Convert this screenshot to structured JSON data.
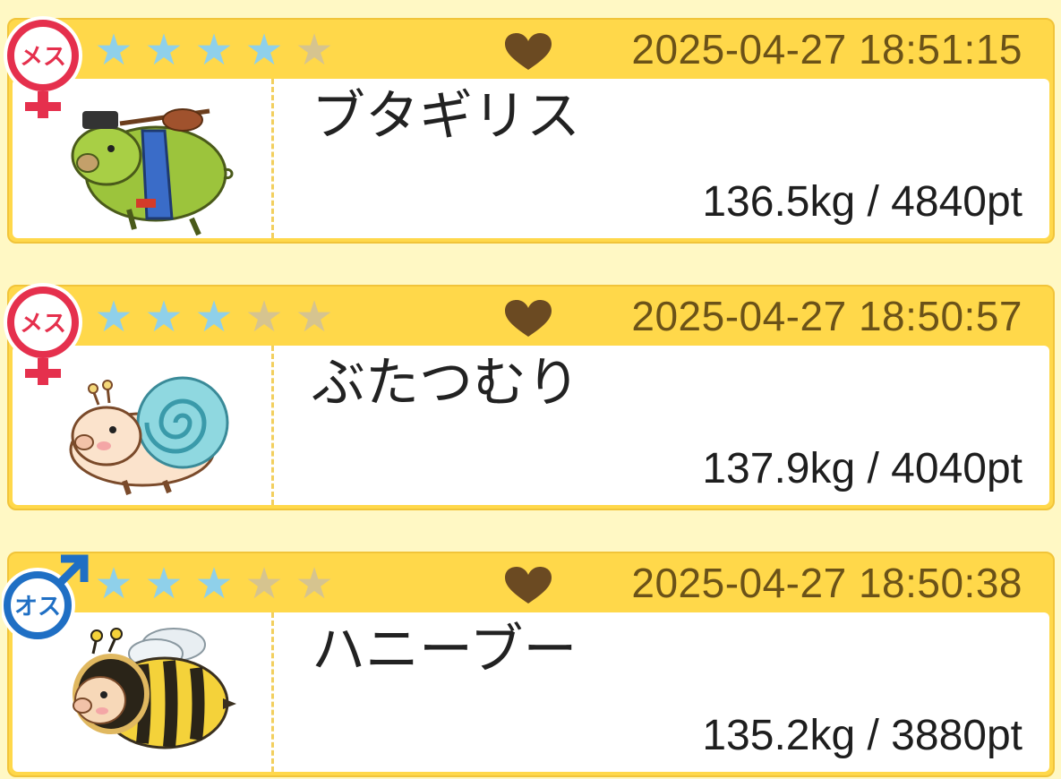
{
  "accent_color": "#ffd84a",
  "star_on_color": "#8fd0ea",
  "star_off_color": "#d6c48f",
  "pigs": [
    {
      "gender_label": "メス",
      "gender": "female",
      "rating": 4,
      "max_rating": 5,
      "datetime": "2025-04-27 18:51:15",
      "name": "ブタギリス",
      "stats": "136.5kg / 4840pt",
      "icon": "grasshopper-pig-icon"
    },
    {
      "gender_label": "メス",
      "gender": "female",
      "rating": 3,
      "max_rating": 5,
      "datetime": "2025-04-27 18:50:57",
      "name": "ぶたつむり",
      "stats": "137.9kg / 4040pt",
      "icon": "snail-pig-icon"
    },
    {
      "gender_label": "オス",
      "gender": "male",
      "rating": 3,
      "max_rating": 5,
      "datetime": "2025-04-27 18:50:38",
      "name": "ハニーブー",
      "stats": "135.2kg / 3880pt",
      "icon": "bee-pig-icon"
    }
  ]
}
